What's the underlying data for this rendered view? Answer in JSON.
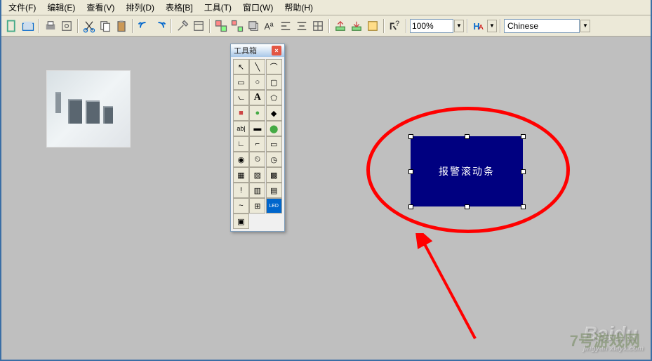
{
  "menubar": {
    "items": [
      "文件(F)",
      "编辑(E)",
      "查看(V)",
      "排列(D)",
      "表格[B]",
      "工具(T)",
      "窗口(W)",
      "帮助(H)"
    ]
  },
  "toolbar": {
    "zoom_value": "100%",
    "lang_value": "Chinese"
  },
  "toolbox": {
    "title": "工具箱",
    "tools": [
      {
        "name": "pointer",
        "glyph": "↖"
      },
      {
        "name": "line",
        "glyph": "╲"
      },
      {
        "name": "arc",
        "glyph": "⌒"
      },
      {
        "name": "rectangle",
        "glyph": "▭"
      },
      {
        "name": "ellipse",
        "glyph": "○"
      },
      {
        "name": "rounded-rect",
        "glyph": "▢"
      },
      {
        "name": "polyline",
        "glyph": "⦦"
      },
      {
        "name": "text",
        "glyph": "A"
      },
      {
        "name": "polygon",
        "glyph": "⬠"
      },
      {
        "name": "filled-rect",
        "glyph": "■"
      },
      {
        "name": "filled-ellipse",
        "glyph": "●"
      },
      {
        "name": "filled-shape",
        "glyph": "◆"
      },
      {
        "name": "edit-text",
        "glyph": "ab|"
      },
      {
        "name": "color-bar",
        "glyph": "▬"
      },
      {
        "name": "indicator",
        "glyph": "⬤"
      },
      {
        "name": "angle",
        "glyph": "∟"
      },
      {
        "name": "curve",
        "glyph": "⌐"
      },
      {
        "name": "button",
        "glyph": "▭"
      },
      {
        "name": "meter",
        "glyph": "◉"
      },
      {
        "name": "clock",
        "glyph": "⏲"
      },
      {
        "name": "dial",
        "glyph": "◷"
      },
      {
        "name": "grid",
        "glyph": "▦"
      },
      {
        "name": "hatch",
        "glyph": "▨"
      },
      {
        "name": "pattern",
        "glyph": "▩"
      },
      {
        "name": "alarm",
        "glyph": "!"
      },
      {
        "name": "table",
        "glyph": "▥"
      },
      {
        "name": "chart",
        "glyph": "▤"
      },
      {
        "name": "trend",
        "glyph": "~"
      },
      {
        "name": "history",
        "glyph": "⊞"
      },
      {
        "name": "led",
        "glyph": "LED"
      },
      {
        "name": "image",
        "glyph": "▣"
      }
    ]
  },
  "alarm_component": {
    "label": "报警滚动条"
  },
  "watermark": {
    "main": "Baidu",
    "sub": "jingyan xlayx.com",
    "right": "7号游戏网"
  }
}
